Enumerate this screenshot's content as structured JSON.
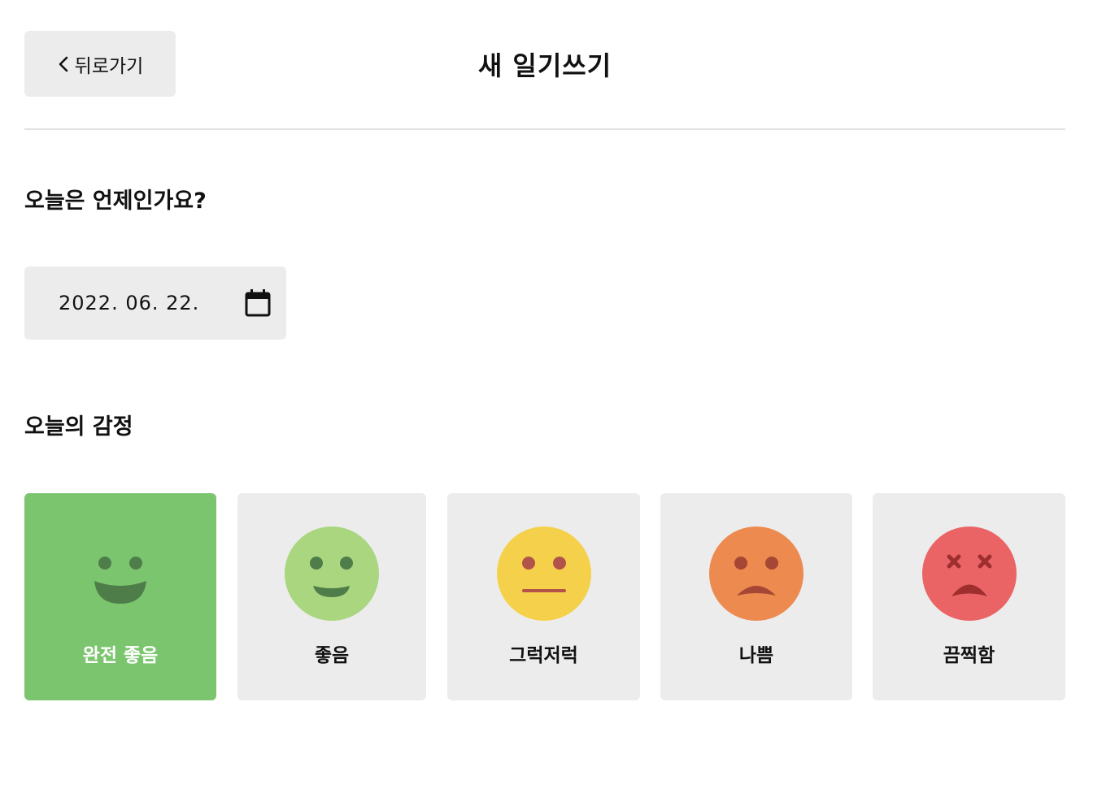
{
  "header": {
    "back_label": "뒤로가기",
    "title": "새 일기쓰기"
  },
  "date_section": {
    "title": "오늘은 언제인가요?",
    "value": "2022. 06. 22.",
    "icon": "calendar-icon"
  },
  "emotion_section": {
    "title": "오늘의 감정",
    "items": [
      {
        "label": "완전 좋음",
        "selected": true,
        "color": "#7cc56f",
        "face_color": "#7cc56f",
        "feature_color": "#4f7d4a",
        "icon": "laughing-face-icon"
      },
      {
        "label": "좋음",
        "selected": false,
        "color": "#ececec",
        "face_color": "#a9d67e",
        "feature_color": "#4f7d4a",
        "icon": "smiling-face-icon"
      },
      {
        "label": "그럭저럭",
        "selected": false,
        "color": "#ececec",
        "face_color": "#f5d14b",
        "feature_color": "#b2534a",
        "icon": "neutral-face-icon"
      },
      {
        "label": "나쁨",
        "selected": false,
        "color": "#ececec",
        "face_color": "#ec8a50",
        "feature_color": "#a54734",
        "icon": "frowning-face-icon"
      },
      {
        "label": "끔찍함",
        "selected": false,
        "color": "#ececec",
        "face_color": "#eb6465",
        "feature_color": "#9f2f2f",
        "icon": "dizzy-face-icon"
      }
    ]
  }
}
